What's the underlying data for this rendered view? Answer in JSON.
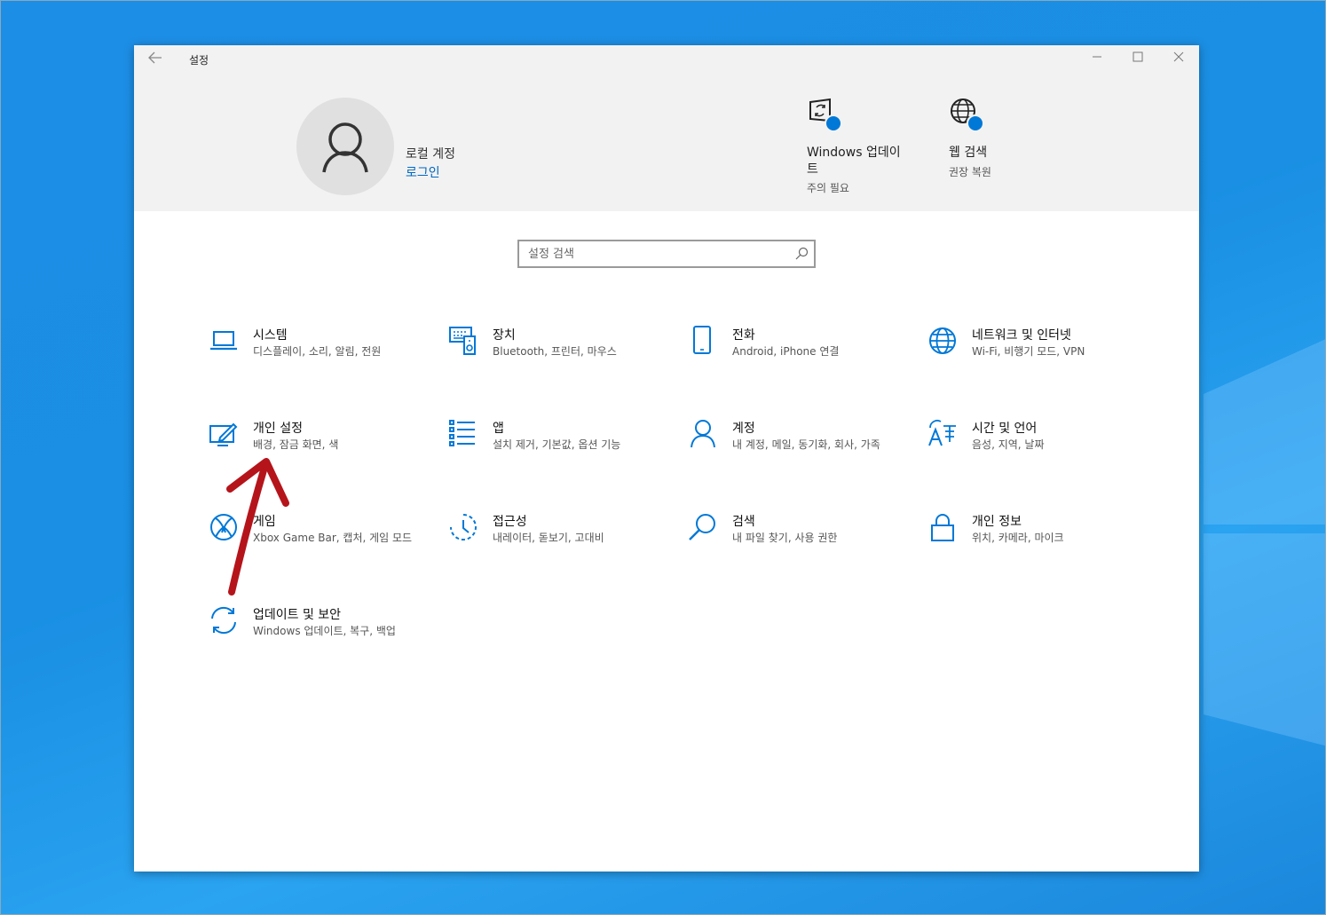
{
  "window": {
    "title": "설정",
    "back_icon": "back-arrow-icon",
    "minimize_icon": "minimize-icon",
    "maximize_icon": "maximize-icon",
    "close_icon": "close-icon"
  },
  "account": {
    "type": "로컬 계정",
    "login_link": "로그인"
  },
  "header_tiles": [
    {
      "title": "Windows 업데이트",
      "status": "주의 필요",
      "icon": "windows-update-icon"
    },
    {
      "title": "웹 검색",
      "status": "권장 복원",
      "icon": "globe-icon"
    }
  ],
  "search": {
    "placeholder": "설정 검색"
  },
  "categories": [
    {
      "title": "시스템",
      "desc": "디스플레이, 소리, 알림, 전원",
      "icon": "laptop-icon"
    },
    {
      "title": "장치",
      "desc": "Bluetooth, 프린터, 마우스",
      "icon": "keyboard-speaker-icon"
    },
    {
      "title": "전화",
      "desc": "Android, iPhone 연결",
      "icon": "phone-icon"
    },
    {
      "title": "네트워크 및 인터넷",
      "desc": "Wi-Fi, 비행기 모드, VPN",
      "icon": "globe-icon"
    },
    {
      "title": "개인 설정",
      "desc": "배경, 잠금 화면, 색",
      "icon": "paint-monitor-icon"
    },
    {
      "title": "앱",
      "desc": "설치 제거, 기본값, 옵션 기능",
      "icon": "apps-list-icon"
    },
    {
      "title": "계정",
      "desc": "내 계정, 메일, 동기화, 회사, 가족",
      "icon": "person-icon"
    },
    {
      "title": "시간 및 언어",
      "desc": "음성, 지역, 날짜",
      "icon": "language-icon"
    },
    {
      "title": "게임",
      "desc": "Xbox Game Bar, 캡처, 게임 모드",
      "icon": "xbox-icon"
    },
    {
      "title": "접근성",
      "desc": "내레이터, 돋보기, 고대비",
      "icon": "ease-of-access-icon"
    },
    {
      "title": "검색",
      "desc": "내 파일 찾기, 사용 권한",
      "icon": "search-icon"
    },
    {
      "title": "개인 정보",
      "desc": "위치, 카메라, 마이크",
      "icon": "lock-icon"
    },
    {
      "title": "업데이트 및 보안",
      "desc": "Windows 업데이트, 복구, 백업",
      "icon": "sync-icon"
    }
  ],
  "colors": {
    "accent": "#0078d7",
    "link": "#0067c0",
    "annotation_arrow": "#b5141b",
    "desktop": "#1a8fe3"
  }
}
